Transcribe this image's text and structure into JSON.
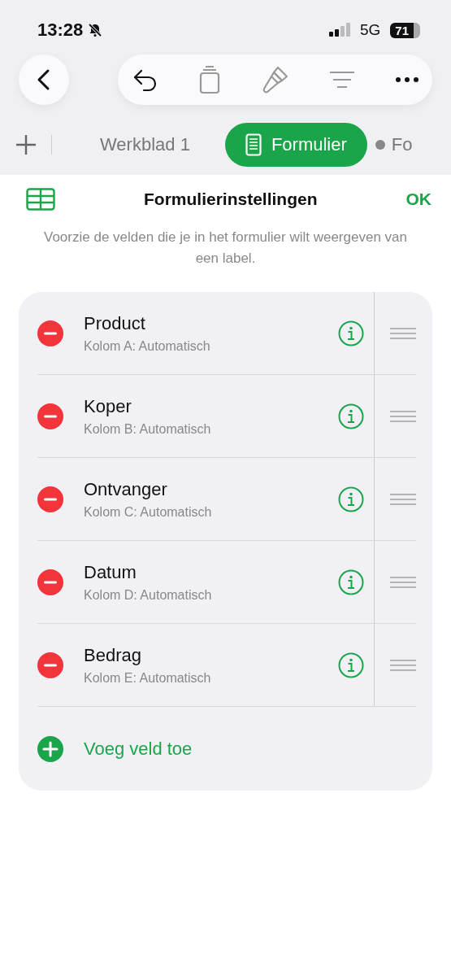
{
  "status_bar": {
    "time": "13:28",
    "network": "5G",
    "battery": "71"
  },
  "tabs": [
    {
      "label": "Werkblad 1",
      "selected": false,
      "kind": "sheet"
    },
    {
      "label": "Formulier",
      "selected": true,
      "kind": "form"
    },
    {
      "label": "Fo",
      "selected": false,
      "kind": "dot"
    }
  ],
  "header": {
    "title": "Formulierinstellingen",
    "done": "OK"
  },
  "description": "Voorzie de velden die je in het formulier wilt weergeven van een label.",
  "fields": [
    {
      "label": "Product",
      "column": "Kolom A: Automatisch"
    },
    {
      "label": "Koper",
      "column": "Kolom B: Automatisch"
    },
    {
      "label": "Ontvanger",
      "column": "Kolom C: Automatisch"
    },
    {
      "label": "Datum",
      "column": "Kolom D: Automatisch"
    },
    {
      "label": "Bedrag",
      "column": "Kolom E: Automatisch"
    }
  ],
  "add_field": "Voeg veld toe"
}
